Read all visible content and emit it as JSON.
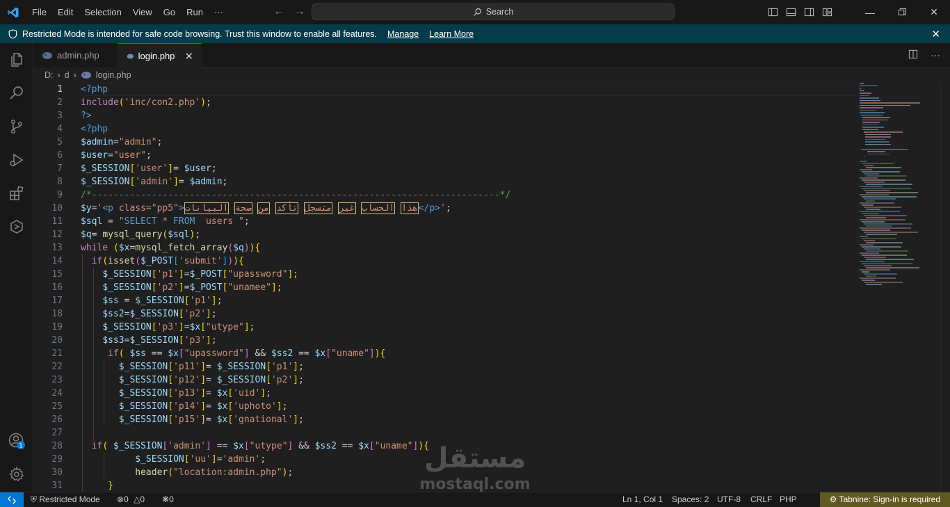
{
  "titlebar": {
    "menu": [
      "File",
      "Edit",
      "Selection",
      "View",
      "Go",
      "Run",
      "···"
    ],
    "search_placeholder": "Search"
  },
  "banner": {
    "message": "Restricted Mode is intended for safe code browsing. Trust this window to enable all features.",
    "manage": "Manage",
    "learn_more": "Learn More"
  },
  "tabs": [
    {
      "label": "admin.php",
      "active": false
    },
    {
      "label": "login.php",
      "active": true
    }
  ],
  "breadcrumb": {
    "drive": "D:",
    "folder": "d",
    "file": "login.php"
  },
  "editor": {
    "current_line": 1,
    "line_numbers": [
      "1",
      "2",
      "3",
      "4",
      "5",
      "6",
      "7",
      "8",
      "9",
      "10",
      "11",
      "12",
      "13",
      "14",
      "15",
      "16",
      "17",
      "18",
      "19",
      "20",
      "21",
      "22",
      "23",
      "24",
      "25",
      "26",
      "27",
      "28",
      "29",
      "30",
      "31"
    ],
    "lines": [
      "<?php",
      "include('inc/con2.php');",
      "?>",
      "<?php",
      "$admin=\"admin\";",
      "$user=\"user\";",
      "$_SESSION['user']= $user;",
      "$_SESSION['admin']= $admin;",
      "/*---------------------------------------------------------------------------*/",
      "$y='<p class=\"pp5\">هذا الحساب غير متسجل تأكد من صحة البيانات</p>';",
      "$sql = \"SELECT * FROM  users \";",
      "$q= mysql_query($sql);",
      "while ($x=mysql_fetch_array($q)){",
      "  if(isset($_POST['submit'])){",
      "    $_SESSION['p1']=$_POST[\"upassword\"];",
      "    $_SESSION['p2']=$_POST[\"unamee\"];",
      "    $ss = $_SESSION['p1'];",
      "    $ss2=$_SESSION['p2'];",
      "    $_SESSION['p3']=$x[\"utype\"];",
      "    $ss3=$_SESSION['p3'];",
      "     if( $ss == $x[\"upassword\"] && $ss2 == $x[\"uname\"]){",
      "       $_SESSION['p11']= $_SESSION['p1'];",
      "       $_SESSION['p12']= $_SESSION['p2'];",
      "       $_SESSION['p13']= $x['uid'];",
      "       $_SESSION['p14']= $x['uphoto'];",
      "       $_SESSION['p15']= $x['gnational'];",
      "",
      "  if( $_SESSION['admin'] == $x[\"utype\"] && $ss2 == $x[\"uname\"]){",
      "          $_SESSION['uu']='admin';",
      "          header(\"location:admin.php\");",
      "     }"
    ]
  },
  "statusbar": {
    "restricted": "Restricted Mode",
    "errors": "0",
    "warnings": "0",
    "ports": "0",
    "position": "Ln 1, Col 1",
    "spaces": "Spaces: 2",
    "encoding": "UTF-8",
    "eol": "CRLF",
    "language": "PHP",
    "tabnine": "Tabnine: Sign-in is required"
  },
  "watermark": {
    "arabic": "مستقل",
    "latin": "mostaql.com"
  },
  "colors": {
    "accent": "#0078d4",
    "banner": "#063b49",
    "tabnine_bg": "#5f5a20"
  },
  "icons": [
    "vscode-logo-icon",
    "explorer-icon",
    "search-icon",
    "source-control-icon",
    "run-debug-icon",
    "extensions-icon",
    "remote-explorer-icon",
    "accounts-icon",
    "manage-gear-icon",
    "shield-icon",
    "close-icon",
    "php-elephant-icon",
    "split-editor-icon",
    "more-actions-icon"
  ]
}
